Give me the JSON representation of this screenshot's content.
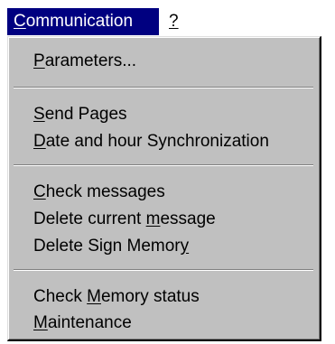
{
  "menubar": {
    "communication": {
      "prefix": "",
      "accel": "C",
      "rest": "ommunication"
    },
    "help": {
      "accel": "?"
    }
  },
  "menu": {
    "items": [
      {
        "prefix": "",
        "accel": "P",
        "rest": "arameters..."
      },
      {
        "prefix": "",
        "accel": "S",
        "rest": "end Pages"
      },
      {
        "prefix": "",
        "accel": "D",
        "rest": "ate and hour Synchronization"
      },
      {
        "prefix": "",
        "accel": "C",
        "rest": "heck messages"
      },
      {
        "prefix": "Delete current ",
        "accel": "m",
        "rest": "essage"
      },
      {
        "prefix": "Delete Sign Memor",
        "accel": "y",
        "rest": ""
      },
      {
        "prefix": "Check ",
        "accel": "M",
        "rest": "emory status"
      },
      {
        "prefix": "",
        "accel": "M",
        "rest": "aintenance"
      }
    ]
  }
}
